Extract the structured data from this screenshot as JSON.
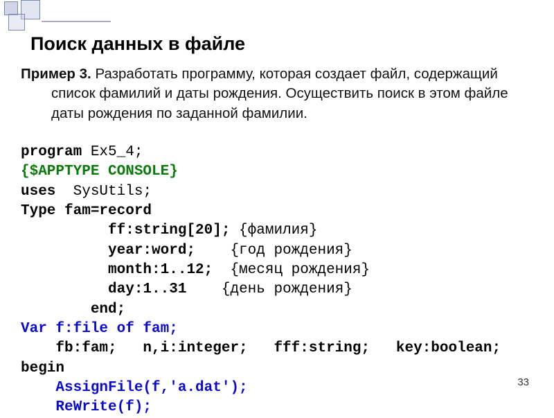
{
  "title": "Поиск данных в файле",
  "desc_label": "Пример 3.",
  "desc_text": " Разработать программу, которая создает файл, содержащий список фамилий и даты рождения. Осуществить поиск в этом файле даты рождения по заданной фамилии.",
  "code": {
    "l1a": "program",
    "l1b": " Ex5_4;",
    "l2": "{$APPTYPE CONSOLE}",
    "l3a": "uses",
    "l3b": "  SysUtils;",
    "l4a": "Type fam=record",
    "l5a": "          ff:string[20];",
    "l5c": " {фамилия}",
    "l6a": "          year:word;",
    "l6c": "    {год рождения}",
    "l7a": "          month:1..12;",
    "l7c": "  {месяц рождения}",
    "l8a": "          day:1..31",
    "l8c": "    {день рождения}",
    "l9": "        end;",
    "l10": "Var f:file of fam;",
    "l11": "    fb:fam;   n,i:integer;   fff:string;   key:boolean;",
    "l12": "begin",
    "l13": "    AssignFile(f,'a.dat');",
    "l14": "    ReWrite(f);"
  },
  "pagenum": "33"
}
